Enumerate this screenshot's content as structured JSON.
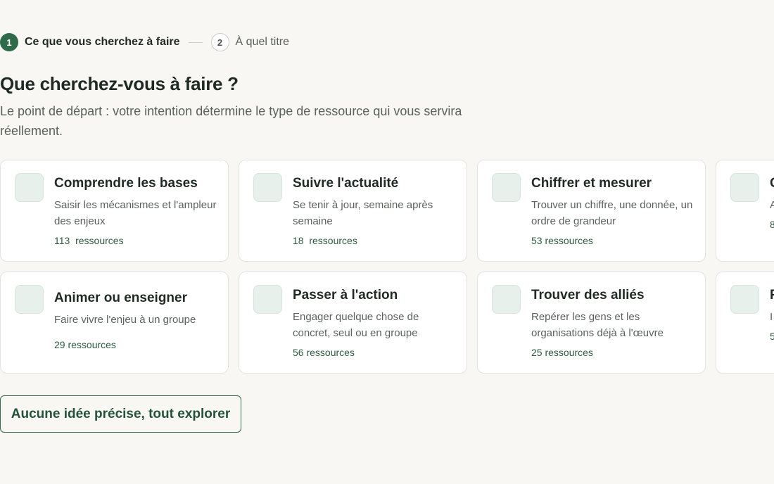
{
  "stepper": {
    "steps": [
      {
        "number": "1",
        "label": "Ce que vous cherchez à faire",
        "state": "active"
      },
      {
        "number": "2",
        "label": "À quel titre",
        "state": "inactive"
      }
    ]
  },
  "header": {
    "title": "Que cherchez-vous à faire ?",
    "subtitle": "Le point de départ : votre intention détermine le type de ressource qui vous servira réellement."
  },
  "cards": [
    {
      "icon": "intent-icon",
      "title": "Comprendre les bases",
      "description": "Saisir les mécanismes et l'ampleur des enjeux",
      "count": "113  ressources"
    },
    {
      "icon": "intent-icon",
      "title": "Suivre l'actualité",
      "description": "Se tenir à jour, semaine après semaine",
      "count": "18  ressources"
    },
    {
      "icon": "intent-icon",
      "title": "Chiffrer et mesurer",
      "description": "Trouver un chiffre, une donnée, un ordre de grandeur",
      "count": "53 ressources"
    },
    {
      "icon": "intent-icon",
      "title": "C",
      "description": "A u",
      "count": "8"
    },
    {
      "icon": "intent-icon",
      "title": "Animer ou enseigner",
      "description": "Faire vivre l'enjeu à un groupe",
      "count": "29 ressources"
    },
    {
      "icon": "intent-icon",
      "title": "Passer à l'action",
      "description": "Engager quelque chose de concret, seul ou en groupe",
      "count": "56 ressources"
    },
    {
      "icon": "intent-icon",
      "title": "Trouver des alliés",
      "description": "Repérer les gens et les organisations déjà à l'œuvre",
      "count": "25 ressources"
    },
    {
      "icon": "intent-icon",
      "title": "P",
      "description": "I p",
      "count": "5"
    }
  ],
  "actions": {
    "explore_all_label": "Aucune idée précise, tout explorer"
  },
  "colors": {
    "accent": "#2f6a4a",
    "background": "#f8f7f4",
    "card_background": "#ffffff",
    "icon_tile": "#e7f0ea"
  }
}
